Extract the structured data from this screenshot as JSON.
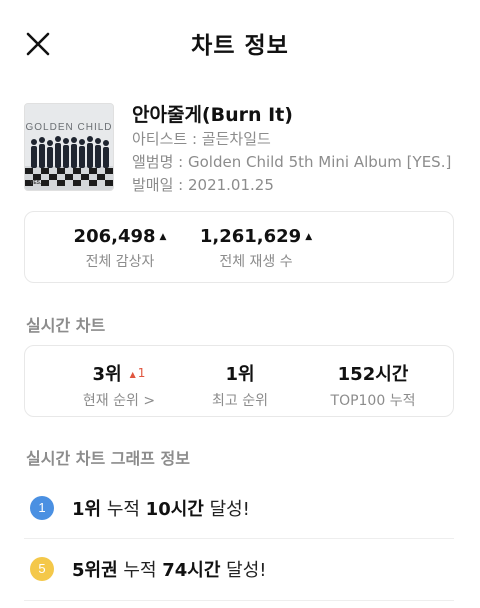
{
  "header": {
    "title": "차트 정보"
  },
  "album": {
    "cover_title": "GOLDEN CHILD",
    "cover_label": "YES.",
    "song_title": "안아줄게(Burn It)",
    "artist_line": "아티스트 : 골든차일드",
    "album_line": "앨범명 : Golden Child 5th Mini Album   [YES.]",
    "release_line": "발매일 : 2021.01.25"
  },
  "stats": {
    "listeners_value": "206,498",
    "listeners_label": "전체 감상자",
    "plays_value": "1,261,629",
    "plays_label": "전체 재생 수",
    "trend_icon": "caret-up-icon"
  },
  "realtime": {
    "section_title": "실시간 차트",
    "current_rank": "3위",
    "current_change": "1",
    "current_label": "현재 순위 >",
    "best_rank": "1위",
    "best_label": "최고 순위",
    "top100_hours": "152시간",
    "top100_label": "TOP100 누적"
  },
  "graph": {
    "section_title": "실시간 차트 그래프 정보",
    "items": [
      {
        "badge": "1",
        "strong1": "1위",
        "text1": " 누적 ",
        "strong2": "10시간",
        "text2": " 달성!"
      },
      {
        "badge": "5",
        "strong1": "5위권",
        "text1": " 누적 ",
        "strong2": "74시간",
        "text2": " 달성!"
      }
    ]
  },
  "colors": {
    "accent_blue": "#4a90e2",
    "accent_yellow": "#f4c84a",
    "rank_up": "#e0563f"
  }
}
